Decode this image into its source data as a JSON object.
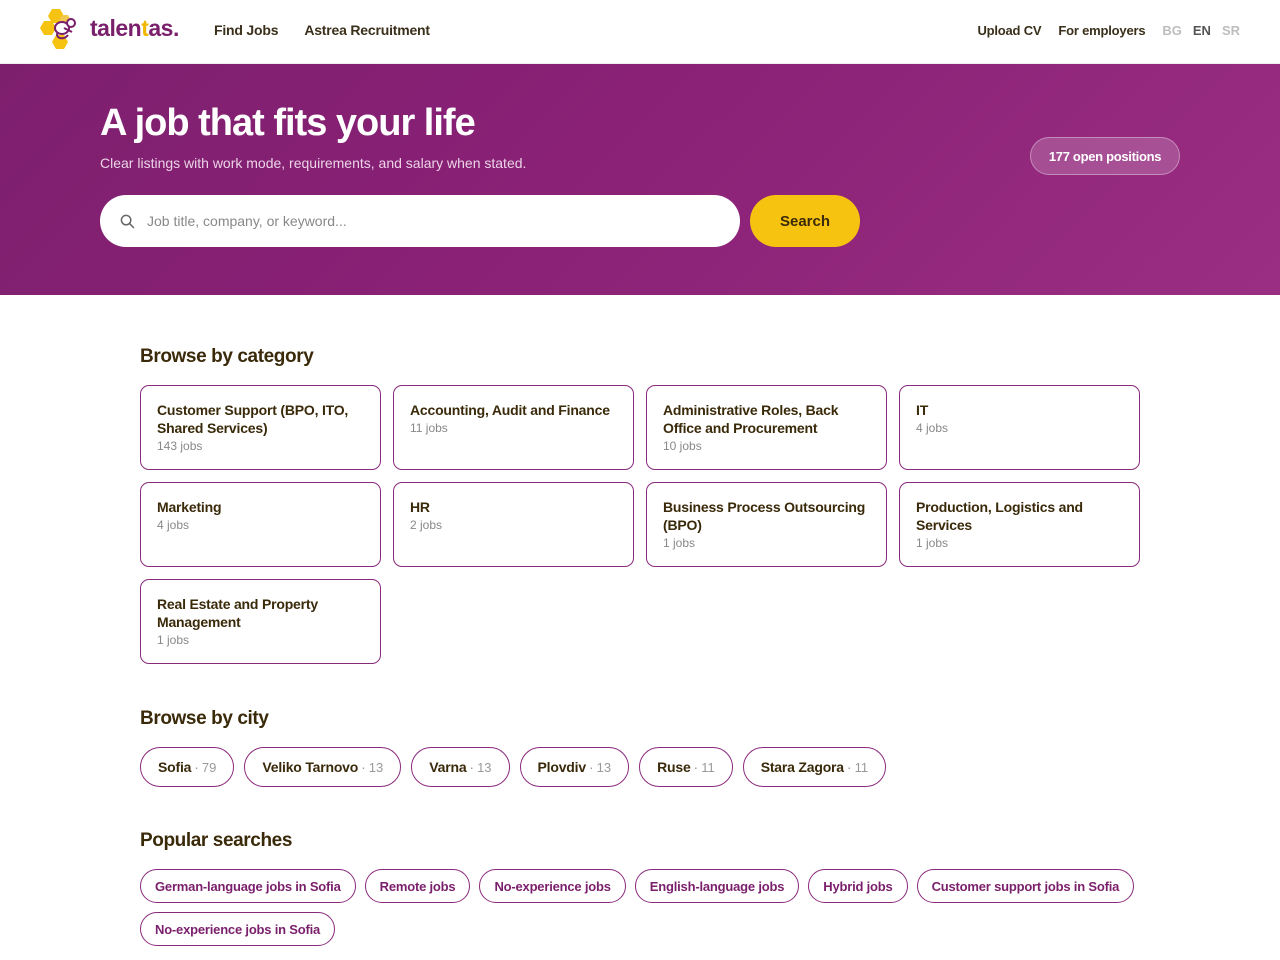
{
  "header": {
    "logo_text_a": "talen",
    "logo_text_b": "t",
    "logo_text_c": "as.",
    "nav_left": [
      "Find Jobs",
      "Astrea Recruitment"
    ],
    "upload_cv": "Upload CV",
    "for_employers": "For employers",
    "languages": [
      "BG",
      "EN",
      "SR"
    ],
    "active_language": "EN"
  },
  "hero": {
    "title": "A job that fits your life",
    "subtitle": "Clear listings with work mode, requirements, and salary when stated.",
    "positions_badge": "177 open positions",
    "search_placeholder": "Job title, company, or keyword...",
    "search_button": "Search"
  },
  "categories": {
    "title": "Browse by category",
    "items": [
      {
        "name": "Customer Support (BPO, ITO, Shared Services)",
        "count": "143 jobs"
      },
      {
        "name": "Accounting, Audit and Finance",
        "count": "11 jobs"
      },
      {
        "name": "Administrative Roles, Back Office and Procurement",
        "count": "10 jobs"
      },
      {
        "name": "IT",
        "count": "4 jobs"
      },
      {
        "name": "Marketing",
        "count": "4 jobs"
      },
      {
        "name": "HR",
        "count": "2 jobs"
      },
      {
        "name": "Business Process Outsourcing (BPO)",
        "count": "1 jobs"
      },
      {
        "name": "Production, Logistics and Services",
        "count": "1 jobs"
      },
      {
        "name": "Real Estate and Property Management",
        "count": "1 jobs"
      }
    ]
  },
  "cities": {
    "title": "Browse by city",
    "items": [
      {
        "name": "Sofia",
        "count": "79"
      },
      {
        "name": "Veliko Tarnovo",
        "count": "13"
      },
      {
        "name": "Varna",
        "count": "13"
      },
      {
        "name": "Plovdiv",
        "count": "13"
      },
      {
        "name": "Ruse",
        "count": "11"
      },
      {
        "name": "Stara Zagora",
        "count": "11"
      }
    ]
  },
  "popular": {
    "title": "Popular searches",
    "items": [
      "German-language jobs in Sofia",
      "Remote jobs",
      "No-experience jobs",
      "English-language jobs",
      "Hybrid jobs",
      "Customer support jobs in Sofia",
      "No-experience jobs in Sofia"
    ]
  },
  "colors": {
    "brand_purple": "#7e1f6e",
    "accent_yellow": "#f7c311",
    "text_dark": "#3a2a0a"
  }
}
